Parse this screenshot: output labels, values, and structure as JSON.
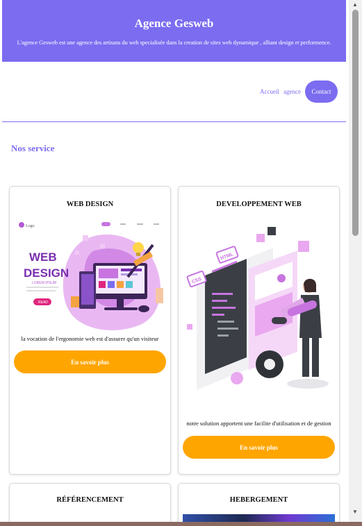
{
  "header": {
    "title": "Agence Gesweb",
    "tagline": "L'agence Gesweb est une agence des artisans du web specialisée dans la creation de sites web dynamique , alliant design et performence."
  },
  "nav": {
    "items": [
      "Accueil",
      "agence",
      "Contact"
    ]
  },
  "section": {
    "title": "Nos service"
  },
  "cards": [
    {
      "title": "WEB DESIGN",
      "description": "la vocation de l'ergonomie web est d'assurer qu'un visiteur",
      "button": "En savoir plus",
      "illustration": {
        "logo_text": "Logo",
        "headline_1": "WEB",
        "headline_2": "DESIGN",
        "subline": "LOREM IPSUM",
        "cta": "READ"
      }
    },
    {
      "title": "DEVELOPPEMENT WEB",
      "description": "notre solution apportent une facilite d'utilisation et de gestion",
      "button": "En savoir plus",
      "illustration": {
        "css_tag": "CSS",
        "html_tag": "HTML"
      }
    },
    {
      "title": "RÉFÉRENCEMENT"
    },
    {
      "title": "HEBERGEMENT"
    }
  ],
  "colors": {
    "primary": "#7b6cf0",
    "accent": "#ffa500"
  }
}
